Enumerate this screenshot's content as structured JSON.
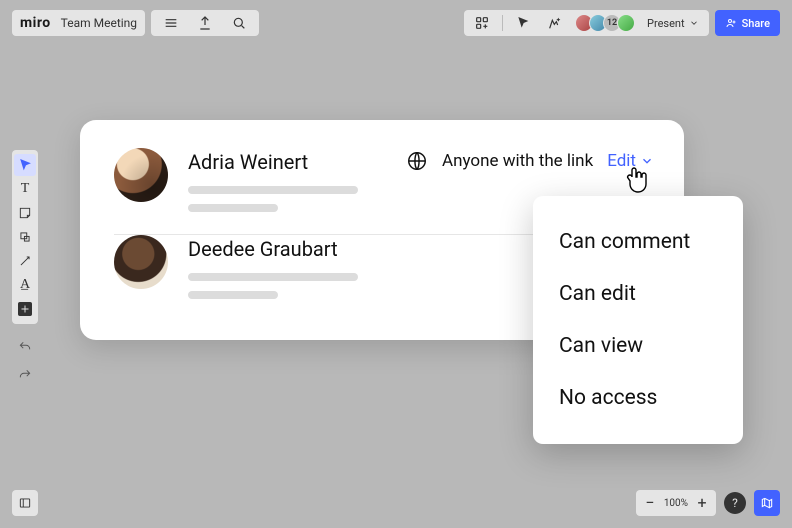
{
  "app": {
    "logo": "miro",
    "board_title": "Team Meeting"
  },
  "topbar_right": {
    "participant_overflow": "12",
    "present_label": "Present",
    "share_label": "Share"
  },
  "share_panel": {
    "users": [
      {
        "name": "Adria Weinert"
      },
      {
        "name": "Deedee Graubart"
      }
    ],
    "link_sharing": {
      "scope_label": "Anyone with the link",
      "permission_label": "Edit"
    }
  },
  "permission_menu": {
    "items": [
      {
        "label": "Can comment"
      },
      {
        "label": "Can edit"
      },
      {
        "label": "Can view"
      },
      {
        "label": "No access"
      }
    ]
  },
  "bottom": {
    "zoom_value": "100%",
    "help_label": "?"
  }
}
